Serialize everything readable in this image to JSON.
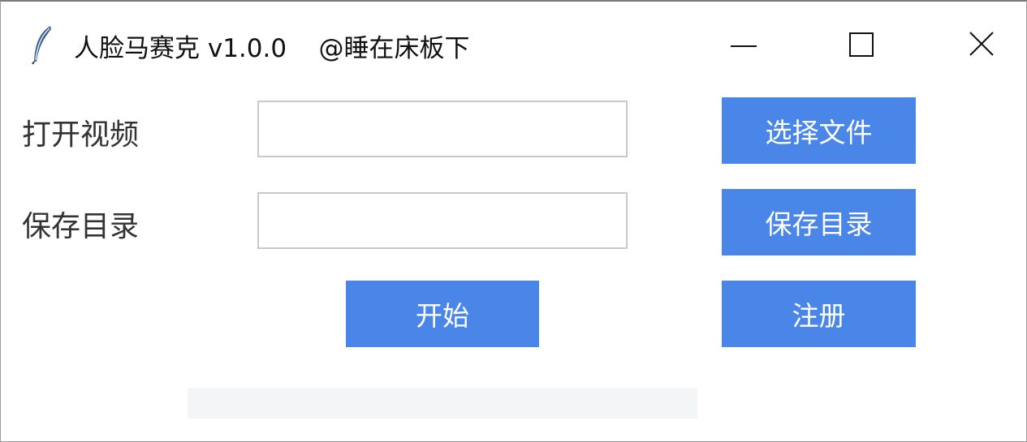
{
  "window": {
    "title": "人脸马赛克 v1.0.0    @睡在床板下",
    "controls": {
      "minimize_icon": "minimize-icon",
      "maximize_icon": "maximize-icon",
      "close_icon": "close-icon"
    }
  },
  "form": {
    "open_video_label": "打开视频",
    "open_video_value": "",
    "save_dir_label": "保存目录",
    "save_dir_value": ""
  },
  "buttons": {
    "choose_file": "选择文件",
    "save_dir": "保存目录",
    "start": "开始",
    "register": "注册"
  },
  "progress": {
    "value": 0
  },
  "colors": {
    "accent": "#4a86e8",
    "progress_track": "#f4f5f7"
  }
}
